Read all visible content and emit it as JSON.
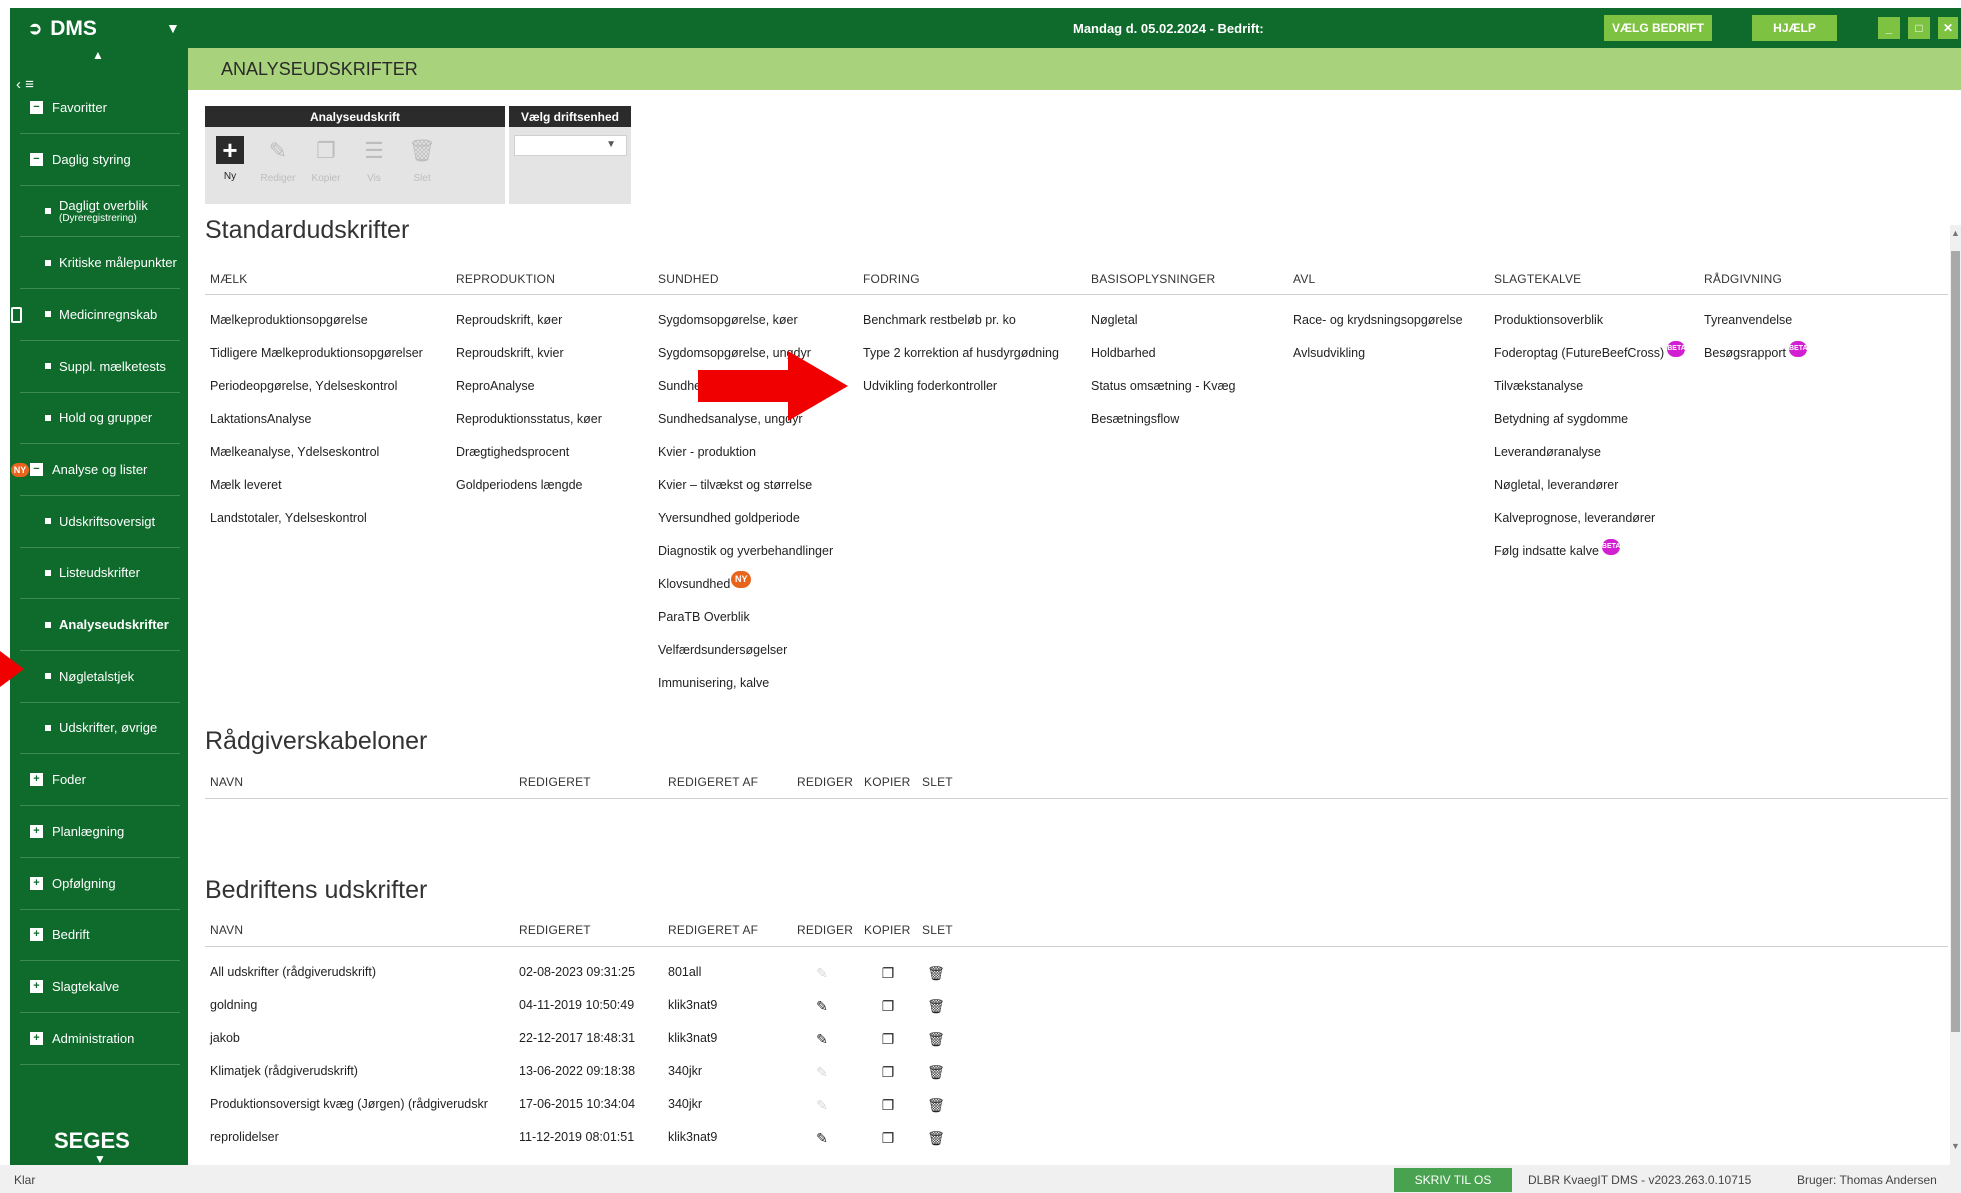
{
  "app": {
    "title": "DMS",
    "date_text": "Mandag d. 05.02.2024 - Bedrift:",
    "btn_select_company": "VÆLG BEDRIFT",
    "btn_help": "HJÆLP"
  },
  "sidebar": {
    "items": [
      {
        "label": "Favoritter",
        "kind": "minus"
      },
      {
        "label": "Daglig styring",
        "kind": "minus"
      },
      {
        "label": "Dagligt overblik",
        "sub": "(Dyreregistrering)",
        "kind": "dot"
      },
      {
        "label": "Kritiske målepunkter",
        "kind": "dot"
      },
      {
        "label": "Medicinregnskab",
        "kind": "dot"
      },
      {
        "label": "Suppl. mælketests",
        "kind": "dot"
      },
      {
        "label": "Hold og grupper",
        "kind": "dot"
      },
      {
        "label": "Analyse og lister",
        "kind": "minus",
        "badge": "NY"
      },
      {
        "label": "Udskriftsoversigt",
        "kind": "dot"
      },
      {
        "label": "Listeudskrifter",
        "kind": "dot"
      },
      {
        "label": "Analyseudskrifter",
        "kind": "dot",
        "active": true
      },
      {
        "label": "Nøgletalstjek",
        "kind": "dot"
      },
      {
        "label": "Udskrifter, øvrige",
        "kind": "dot"
      },
      {
        "label": "Foder",
        "kind": "plus"
      },
      {
        "label": "Planlægning",
        "kind": "plus"
      },
      {
        "label": "Opfølgning",
        "kind": "plus"
      },
      {
        "label": "Bedrift",
        "kind": "plus"
      },
      {
        "label": "Slagtekalve",
        "kind": "plus"
      },
      {
        "label": "Administration",
        "kind": "plus"
      }
    ],
    "brand": "SEGES"
  },
  "page": {
    "title": "ANALYSEUDSKRIFTER"
  },
  "toolbar": {
    "panel_title": "Analyseudskrift",
    "tools": [
      {
        "label": "Ny",
        "icon": "plus-icon",
        "enabled": true
      },
      {
        "label": "Rediger",
        "icon": "pencil-icon",
        "enabled": false
      },
      {
        "label": "Kopier",
        "icon": "copy-icon",
        "enabled": false
      },
      {
        "label": "Vis",
        "icon": "document-icon",
        "enabled": false
      },
      {
        "label": "Slet",
        "icon": "trash-icon",
        "enabled": false
      }
    ],
    "unit_title": "Vælg driftsenhed",
    "unit_value": ""
  },
  "standard": {
    "title": "Standardudskrifter",
    "columns": [
      {
        "head": "MÆLK",
        "items": [
          "Mælkeproduktionsopgørelse",
          "Tidligere Mælkeproduktionsopgørelser",
          "Periodeopgørelse, Ydelseskontrol",
          "LaktationsAnalyse",
          "Mælkeanalyse, Ydelseskontrol",
          "Mælk leveret",
          "Landstotaler, Ydelseskontrol"
        ]
      },
      {
        "head": "REPRODUKTION",
        "items": [
          "Reproudskrift, køer",
          "Reproudskrift, kvier",
          "ReproAnalyse",
          "Reproduktionsstatus, køer",
          "Drægtighedsprocent",
          "Goldperiodens længde"
        ]
      },
      {
        "head": "SUNDHED",
        "items": [
          "Sygdomsopgørelse, køer",
          "Sygdomsopgørelse, ungdyr",
          "Sundhe",
          "Sundhedsanalyse, ungdyr",
          "Kvier - produktion",
          "Kvier – tilvækst og størrelse",
          "Yversundhed goldperiode",
          "Diagnostik og yverbehandlinger",
          "Klovsundhed",
          "ParaTB Overblik",
          "Velfærdsundersøgelser",
          "Immunisering, kalve"
        ]
      },
      {
        "head": "FODRING",
        "items": [
          "Benchmark restbeløb pr. ko",
          "Type 2 korrektion af husdyrgødning",
          "Udvikling foderkontroller"
        ]
      },
      {
        "head": "BASISOPLYSNINGER",
        "items": [
          "Nøgletal",
          "Holdbarhed",
          "Status omsætning - Kvæg",
          "Besætningsflow"
        ]
      },
      {
        "head": "AVL",
        "items": [
          "Race- og krydsningsopgørelse",
          "Avlsudvikling"
        ]
      },
      {
        "head": "SLAGTEKALVE",
        "items": [
          "Produktionsoverblik",
          "Foderoptag (FutureBeefCross)",
          "Tilvækstanalyse",
          "Betydning af sygdomme",
          "Leverandøranalyse",
          "Nøgletal, leverandører",
          "Kalveprognose, leverandører",
          "Følg indsatte kalve"
        ]
      },
      {
        "head": "RÅDGIVNING",
        "items": [
          "Tyreanvendelse",
          "Besøgsrapport"
        ]
      }
    ],
    "badge_beta": "BETA",
    "badge_ny": "NY"
  },
  "templates": {
    "title": "Rådgiverskabeloner",
    "headers": [
      "NAVN",
      "REDIGERET",
      "REDIGERET AF",
      "REDIGER",
      "KOPIER",
      "SLET"
    ]
  },
  "company": {
    "title": "Bedriftens udskrifter",
    "headers": [
      "NAVN",
      "REDIGERET",
      "REDIGERET AF",
      "REDIGER",
      "KOPIER",
      "SLET"
    ],
    "rows": [
      {
        "name": "All udskrifter (rådgiverudskrift)",
        "edited": "02-08-2023 09:31:25",
        "by": "801all",
        "editable": false
      },
      {
        "name": "goldning",
        "edited": "04-11-2019 10:50:49",
        "by": "klik3nat9",
        "editable": true
      },
      {
        "name": "jakob",
        "edited": "22-12-2017 18:48:31",
        "by": "klik3nat9",
        "editable": true
      },
      {
        "name": "Klimatjek  (rådgiverudskrift)",
        "edited": "13-06-2022 09:18:38",
        "by": "340jkr",
        "editable": false
      },
      {
        "name": "Produktionsoversigt kvæg (Jørgen) (rådgiverudskr",
        "edited": "17-06-2015 10:34:04",
        "by": "340jkr",
        "editable": false
      },
      {
        "name": "reprolidelser",
        "edited": "11-12-2019 08:01:51",
        "by": "klik3nat9",
        "editable": true
      }
    ]
  },
  "status": {
    "text": "Klar",
    "write_btn": "SKRIV TIL OS",
    "version": "DLBR KvaegIT DMS - v2023.263.0.10715",
    "user": "Bruger: Thomas Andersen"
  },
  "colors": {
    "dark_green": "#0e6b2c",
    "light_green": "#a9d27c",
    "button_green": "#7ec241",
    "arrow_red": "#f00000",
    "beta": "#d11fd1",
    "ny": "#e8641c"
  }
}
